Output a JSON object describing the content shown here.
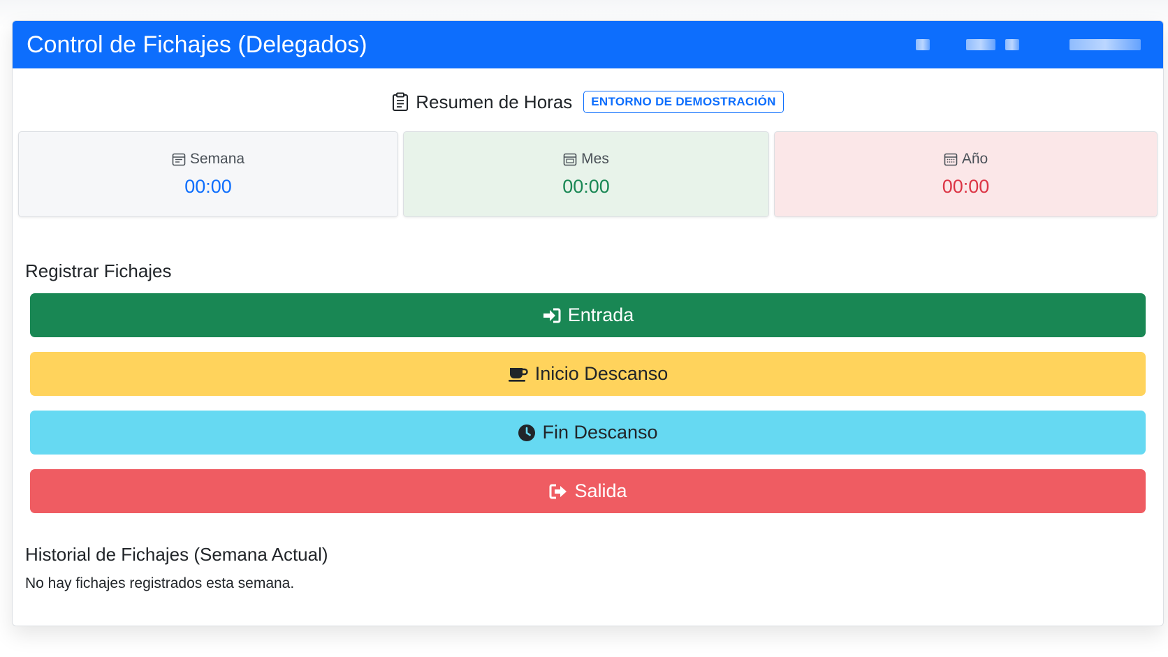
{
  "header": {
    "title": "Control de Fichajes (Delegados)",
    "accent_color": "#0d6efd"
  },
  "summary": {
    "icon": "clipboard-icon",
    "title": "Resumen de Horas",
    "badge": "ENTORNO DE DEMOSTRACIÓN"
  },
  "stats": {
    "week": {
      "icon": "calendar-week-icon",
      "label": "Semana",
      "value": "00:00",
      "color": "#0d6efd"
    },
    "month": {
      "icon": "calendar-month-icon",
      "label": "Mes",
      "value": "00:00",
      "color": "#198754"
    },
    "year": {
      "icon": "calendar-year-icon",
      "label": "Año",
      "value": "00:00",
      "color": "#dc3545"
    }
  },
  "register": {
    "title": "Registrar Fichajes",
    "buttons": {
      "entrada": {
        "icon": "sign-in-icon",
        "label": "Entrada",
        "color": "#198754"
      },
      "inicio_descanso": {
        "icon": "coffee-icon",
        "label": "Inicio Descanso",
        "color": "#ffd35c"
      },
      "fin_descanso": {
        "icon": "clock-icon",
        "label": "Fin Descanso",
        "color": "#66d9f2"
      },
      "salida": {
        "icon": "sign-out-icon",
        "label": "Salida",
        "color": "#ef5c62"
      }
    }
  },
  "history": {
    "title": "Historial de Fichajes (Semana Actual)",
    "empty_message": "No hay fichajes registrados esta semana."
  }
}
